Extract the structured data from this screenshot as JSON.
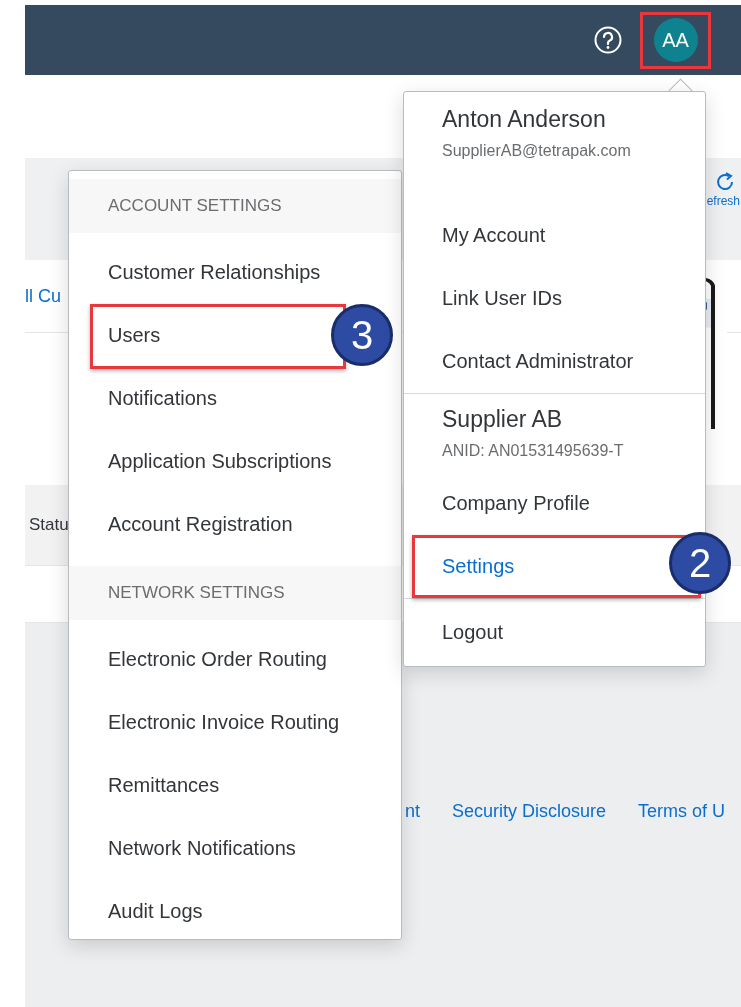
{
  "header": {
    "avatar": {
      "initials": "AA",
      "highlighted": true
    }
  },
  "background": {
    "toolbar_action": "efresh",
    "link": "ll Cu",
    "table_header": "Statu",
    "footer_links": [
      "nt",
      "Security Disclosure",
      "Terms of U"
    ]
  },
  "settings_menu": {
    "sections": [
      {
        "title": "ACCOUNT SETTINGS",
        "items": [
          {
            "label": "Customer Relationships",
            "highlighted": false
          },
          {
            "label": "Users",
            "highlighted": true,
            "callout": "3"
          },
          {
            "label": "Notifications",
            "highlighted": false
          },
          {
            "label": "Application Subscriptions",
            "highlighted": false
          },
          {
            "label": "Account Registration",
            "highlighted": false
          }
        ]
      },
      {
        "title": "NETWORK SETTINGS",
        "items": [
          {
            "label": "Electronic Order Routing",
            "highlighted": false
          },
          {
            "label": "Electronic Invoice Routing",
            "highlighted": false
          },
          {
            "label": "Remittances",
            "highlighted": false
          },
          {
            "label": "Network Notifications",
            "highlighted": false
          },
          {
            "label": "Audit Logs",
            "highlighted": false
          }
        ]
      }
    ]
  },
  "user_menu": {
    "name": "Anton Anderson",
    "email": "SupplierAB@tetrapak.com",
    "items": [
      {
        "label": "My Account",
        "selected": false,
        "highlighted": false
      },
      {
        "label": "Link User IDs",
        "selected": false,
        "highlighted": false
      },
      {
        "label": "Contact Administrator",
        "selected": false,
        "highlighted": false
      }
    ],
    "company": "Supplier AB",
    "anid": "ANID: AN01531495639-T",
    "company_items": [
      {
        "label": "Company Profile",
        "selected": false,
        "highlighted": false
      },
      {
        "label": "Settings",
        "selected": true,
        "highlighted": true,
        "callout": "2"
      }
    ],
    "logout": "Logout"
  }
}
